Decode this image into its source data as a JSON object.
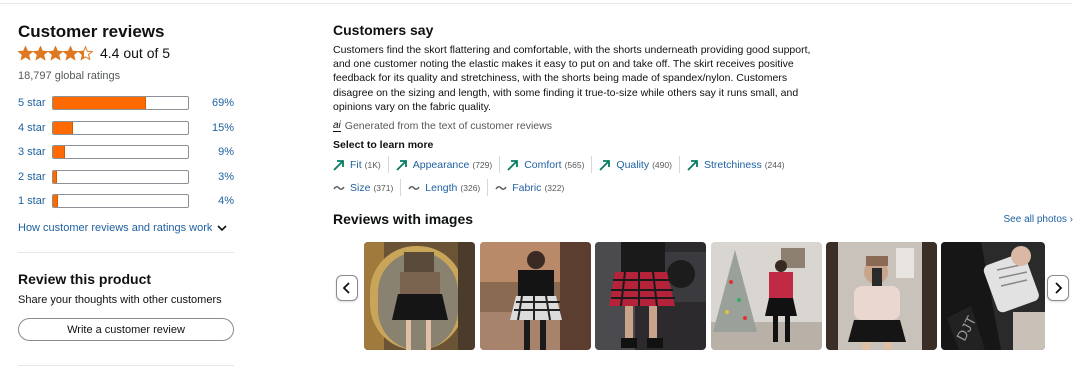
{
  "left": {
    "title": "Customer reviews",
    "rating_value": 4.4,
    "rating_text": "4.4 out of 5",
    "global_ratings": "18,797 global ratings",
    "histogram": [
      {
        "label": "5 star",
        "percent": 69,
        "pct_text": "69%"
      },
      {
        "label": "4 star",
        "percent": 15,
        "pct_text": "15%"
      },
      {
        "label": "3 star",
        "percent": 9,
        "pct_text": "9%"
      },
      {
        "label": "2 star",
        "percent": 3,
        "pct_text": "3%"
      },
      {
        "label": "1 star",
        "percent": 4,
        "pct_text": "4%"
      }
    ],
    "how_link": "How customer reviews and ratings work",
    "review_product": {
      "title": "Review this product",
      "subtitle": "Share your thoughts with other customers",
      "button": "Write a customer review"
    }
  },
  "right": {
    "customers_say_title": "Customers say",
    "summary": "Customers find the skort flattering and comfortable, with the shorts underneath providing good support, and one customer noting the elastic makes it easy to put on and take off. The skirt receives positive feedback for its quality and stretchiness, with the shorts being made of spandex/nylon. Customers disagree on the sizing and length, with some finding it true-to-size while others say it runs small, and opinions vary on the fabric quality.",
    "ai_badge": "ai",
    "ai_note": "Generated from the text of customer reviews",
    "select_label": "Select to learn more",
    "aspects": [
      {
        "name": "Fit",
        "count": "(1K)",
        "sentiment": "positive"
      },
      {
        "name": "Appearance",
        "count": "(729)",
        "sentiment": "positive"
      },
      {
        "name": "Comfort",
        "count": "(565)",
        "sentiment": "positive"
      },
      {
        "name": "Quality",
        "count": "(490)",
        "sentiment": "positive"
      },
      {
        "name": "Stretchiness",
        "count": "(244)",
        "sentiment": "positive"
      },
      {
        "name": "Size",
        "count": "(371)",
        "sentiment": "mixed"
      },
      {
        "name": "Length",
        "count": "(326)",
        "sentiment": "mixed"
      },
      {
        "name": "Fabric",
        "count": "(322)",
        "sentiment": "mixed"
      }
    ],
    "reviews_images_title": "Reviews with images",
    "see_all": "See all photos ›"
  },
  "colors": {
    "star": "#de7921",
    "bar_fill": "#ff6a00",
    "link": "#2162a1",
    "positive_icon": "#067d62",
    "mixed_icon": "#565959"
  },
  "icons": {
    "star": "star-icon",
    "chevron": "chevron-down-icon",
    "positive": "trend-up-icon",
    "mixed": "tilde-icon",
    "prev": "chevron-left-icon",
    "next": "chevron-right-icon"
  }
}
